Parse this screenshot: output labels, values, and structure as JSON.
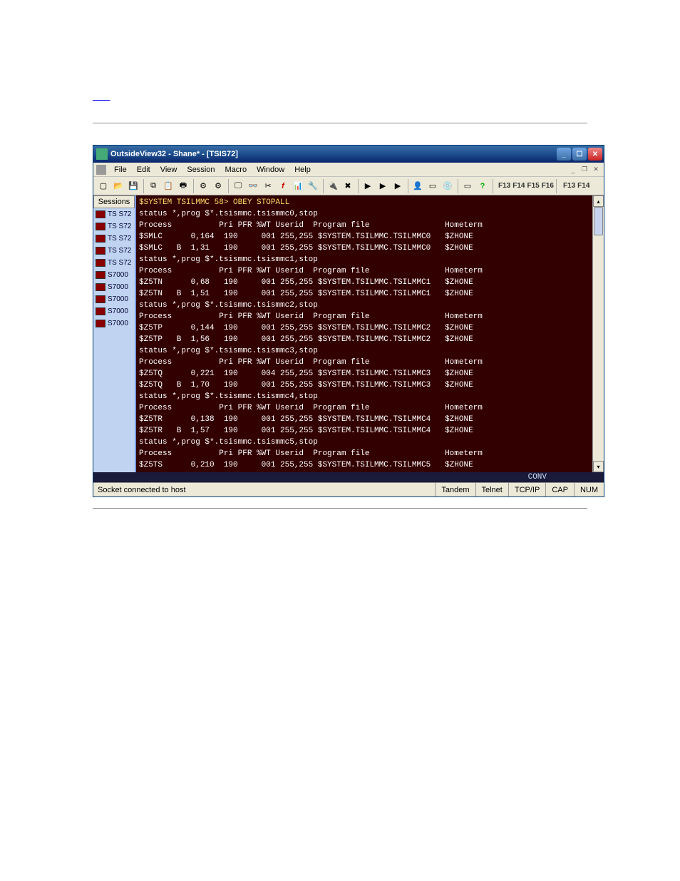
{
  "page_link": "____",
  "window": {
    "title": "OutsideView32 - Shane* - [TSIS72]"
  },
  "menu": {
    "items": [
      "File",
      "Edit",
      "View",
      "Session",
      "Macro",
      "Window",
      "Help"
    ]
  },
  "toolbar": {
    "fkeys_a": [
      "F13",
      "F14",
      "F15",
      "F16"
    ],
    "fkeys_b": [
      "F13",
      "F14"
    ]
  },
  "sidebar": {
    "header": "Sessions",
    "items": [
      {
        "label": "TS S72"
      },
      {
        "label": "TS S72"
      },
      {
        "label": "TS S72"
      },
      {
        "label": "TS S72"
      },
      {
        "label": "TS S72"
      },
      {
        "label": "S7000"
      },
      {
        "label": "S7000"
      },
      {
        "label": "S7000"
      },
      {
        "label": "S7000"
      },
      {
        "label": "S7000"
      }
    ]
  },
  "terminal": {
    "lines": [
      {
        "c": "y",
        "t": "$SYSTEM TSILMMC 58> OBEY STOPALL"
      },
      {
        "c": "w",
        "t": "status *,prog $*.tsismmc.tsismmc0,stop"
      },
      {
        "c": "w",
        "t": "Process          Pri PFR %WT Userid  Program file                Hometerm"
      },
      {
        "c": "w",
        "t": "$SMLC      0,164  190     001 255,255 $SYSTEM.TSILMMC.TSILMMC0   $ZHONE"
      },
      {
        "c": "w",
        "t": "$SMLC   B  1,31   190     001 255,255 $SYSTEM.TSILMMC.TSILMMC0   $ZHONE"
      },
      {
        "c": "w",
        "t": "status *,prog $*.tsismmc.tsismmc1,stop"
      },
      {
        "c": "w",
        "t": "Process          Pri PFR %WT Userid  Program file                Hometerm"
      },
      {
        "c": "w",
        "t": "$Z5TN      0,68   190     001 255,255 $SYSTEM.TSILMMC.TSILMMC1   $ZHONE"
      },
      {
        "c": "w",
        "t": "$Z5TN   B  1,51   190     001 255,255 $SYSTEM.TSILMMC.TSILMMC1   $ZHONE"
      },
      {
        "c": "w",
        "t": "status *,prog $*.tsismmc.tsismmc2,stop"
      },
      {
        "c": "w",
        "t": "Process          Pri PFR %WT Userid  Program file                Hometerm"
      },
      {
        "c": "w",
        "t": "$Z5TP      0,144  190     001 255,255 $SYSTEM.TSILMMC.TSILMMC2   $ZHONE"
      },
      {
        "c": "w",
        "t": "$Z5TP   B  1,56   190     001 255,255 $SYSTEM.TSILMMC.TSILMMC2   $ZHONE"
      },
      {
        "c": "w",
        "t": "status *,prog $*.tsismmc.tsismmc3,stop"
      },
      {
        "c": "w",
        "t": "Process          Pri PFR %WT Userid  Program file                Hometerm"
      },
      {
        "c": "w",
        "t": "$Z5TQ      0,221  190     004 255,255 $SYSTEM.TSILMMC.TSILMMC3   $ZHONE"
      },
      {
        "c": "w",
        "t": "$Z5TQ   B  1,70   190     001 255,255 $SYSTEM.TSILMMC.TSILMMC3   $ZHONE"
      },
      {
        "c": "w",
        "t": "status *,prog $*.tsismmc.tsismmc4,stop"
      },
      {
        "c": "w",
        "t": "Process          Pri PFR %WT Userid  Program file                Hometerm"
      },
      {
        "c": "w",
        "t": "$Z5TR      0,138  190     001 255,255 $SYSTEM.TSILMMC.TSILMMC4   $ZHONE"
      },
      {
        "c": "w",
        "t": "$Z5TR   B  1,57   190     001 255,255 $SYSTEM.TSILMMC.TSILMMC4   $ZHONE"
      },
      {
        "c": "w",
        "t": "status *,prog $*.tsismmc.tsismmc5,stop"
      },
      {
        "c": "w",
        "t": "Process          Pri PFR %WT Userid  Program file                Hometerm"
      },
      {
        "c": "w",
        "t": "$Z5TS      0,210  190     001 255,255 $SYSTEM.TSILMMC.TSILMMC5   $ZHONE"
      }
    ],
    "conv": "CONV     "
  },
  "statusbar": {
    "left": "Socket connected to host",
    "panels": [
      "Tandem",
      "Telnet",
      "TCP/IP",
      "CAP",
      "NUM"
    ]
  }
}
